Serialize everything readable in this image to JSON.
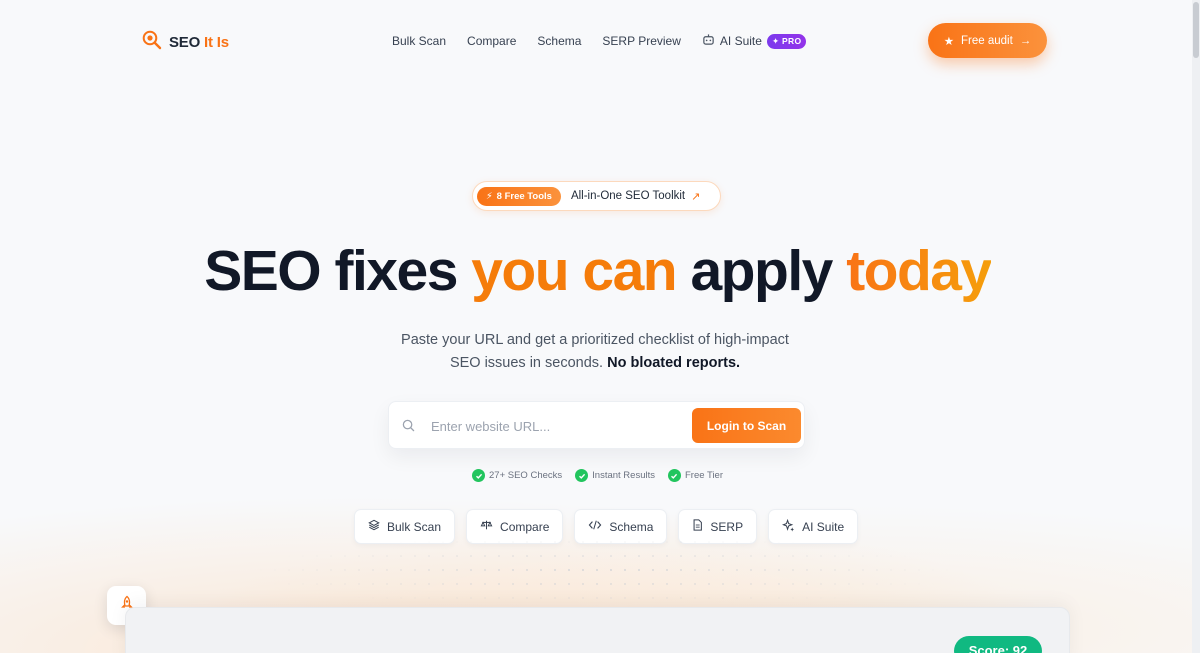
{
  "brand": {
    "name_part1": "SEO",
    "name_part2": "It Is",
    "accent_color": "#f97316"
  },
  "nav": {
    "items": [
      {
        "label": "Bulk Scan"
      },
      {
        "label": "Compare"
      },
      {
        "label": "Schema"
      },
      {
        "label": "SERP Preview"
      },
      {
        "label": "AI Suite",
        "icon": "robot-icon",
        "badge": "PRO"
      }
    ],
    "cta_label": "Free audit"
  },
  "pill": {
    "tag": "8 Free Tools",
    "text": "All-in-One SEO Toolkit"
  },
  "hero": {
    "title_part1": "SEO fixes ",
    "title_part2": "you can",
    "title_part3": " apply ",
    "title_part4": "today",
    "subtitle": "Paste your URL and get a prioritized checklist of high-impact SEO issues in seconds.",
    "subtitle_bold": "No bloated reports."
  },
  "search": {
    "placeholder": "Enter website URL...",
    "button_label": "Login to Scan"
  },
  "checks": [
    {
      "label": "27+ SEO Checks"
    },
    {
      "label": "Instant Results"
    },
    {
      "label": "Free Tier"
    }
  ],
  "tools": [
    {
      "label": "Bulk Scan",
      "icon": "layers-icon"
    },
    {
      "label": "Compare",
      "icon": "scale-icon"
    },
    {
      "label": "Schema",
      "icon": "code-icon"
    },
    {
      "label": "SERP",
      "icon": "document-icon"
    },
    {
      "label": "AI Suite",
      "icon": "sparkles-icon"
    }
  ],
  "preview": {
    "score_label": "Score: 92"
  }
}
